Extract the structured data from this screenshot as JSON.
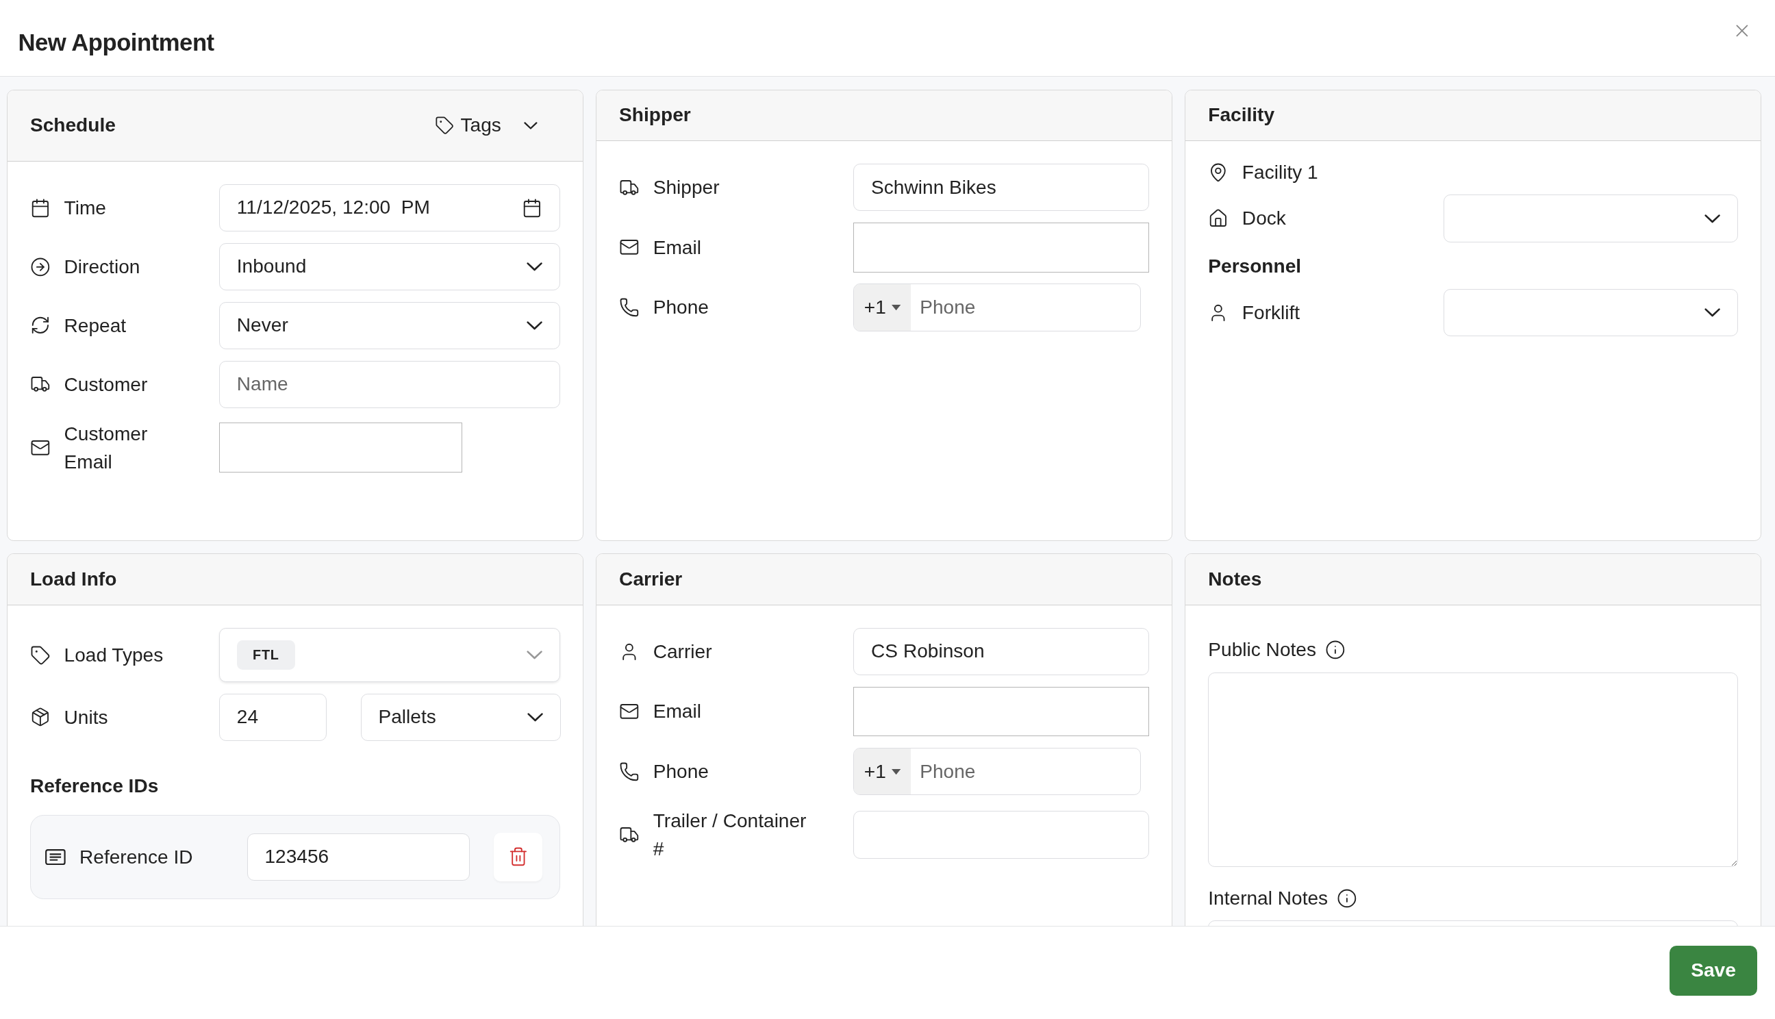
{
  "dialog": {
    "title": "New Appointment"
  },
  "schedule": {
    "title": "Schedule",
    "tags_label": "Tags",
    "fields": [
      {
        "kind": "datetime",
        "label": "Time",
        "value": "11/12/2025, 12:00  PM"
      },
      {
        "kind": "select",
        "label": "Direction",
        "value": "Inbound"
      },
      {
        "kind": "select",
        "label": "Repeat",
        "value": "Never"
      },
      {
        "kind": "text",
        "label": "Customer",
        "placeholder": "Name"
      },
      {
        "kind": "email",
        "label": "Customer Email"
      }
    ]
  },
  "shipper": {
    "title": "Shipper",
    "fields": [
      {
        "kind": "text",
        "label": "Shipper",
        "value": "Schwinn Bikes"
      },
      {
        "kind": "email",
        "label": "Email"
      },
      {
        "kind": "phone",
        "label": "Phone",
        "prefix": "+1",
        "placeholder": "Phone"
      }
    ]
  },
  "facility": {
    "title": "Facility",
    "name": "Facility 1",
    "fields": [
      {
        "kind": "select",
        "label": "Dock"
      }
    ],
    "personnel_title": "Personnel",
    "personnel": [
      {
        "kind": "select",
        "label": "Forklift"
      }
    ]
  },
  "load_info": {
    "title": "Load Info",
    "fields": [
      {
        "kind": "multiselect",
        "label": "Load Types",
        "chips": [
          "FTL"
        ]
      },
      {
        "kind": "units",
        "label": "Units",
        "value": "24",
        "unit": "Pallets"
      }
    ],
    "reference_title": "Reference IDs",
    "references": [
      {
        "label": "Reference ID",
        "value": "123456"
      }
    ]
  },
  "carrier": {
    "title": "Carrier",
    "fields": [
      {
        "kind": "text",
        "label": "Carrier",
        "value": "CS Robinson"
      },
      {
        "kind": "email",
        "label": "Email"
      },
      {
        "kind": "phone",
        "label": "Phone",
        "prefix": "+1",
        "placeholder": "Phone"
      },
      {
        "kind": "text",
        "label": "Trailer / Container #"
      }
    ]
  },
  "notes": {
    "title": "Notes",
    "fields": [
      {
        "label": "Public Notes"
      },
      {
        "label": "Internal Notes"
      }
    ]
  },
  "save_button": "Save"
}
